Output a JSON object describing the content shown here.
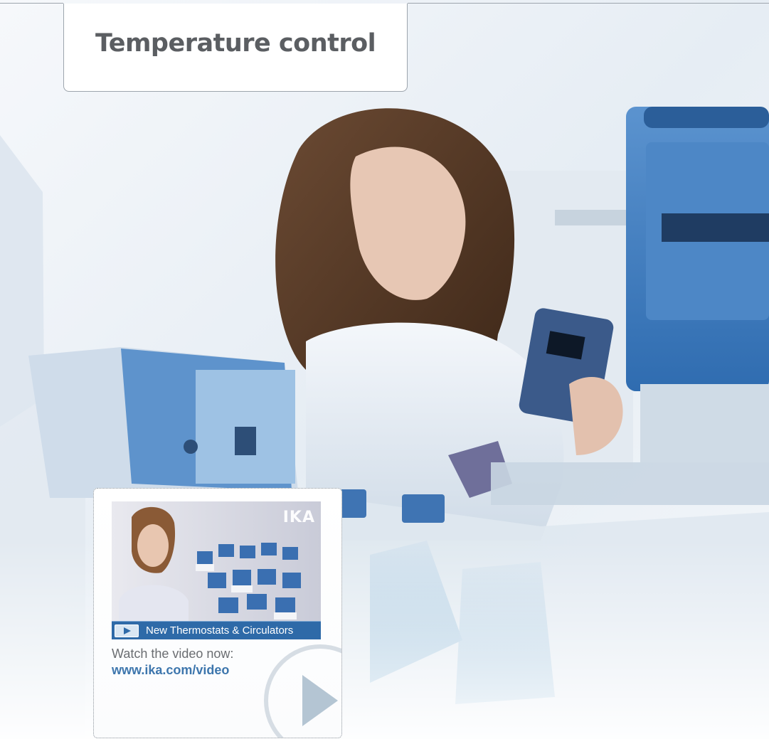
{
  "header": {
    "title": "Temperature control"
  },
  "video_teaser": {
    "thumbnail_caption": "New Thermostats & Circulators",
    "brand_logo": "IKA",
    "watch_label": "Watch the video now:",
    "link_text": "www.ika.com/video",
    "play_icon": "play-icon"
  },
  "colors": {
    "accent_blue": "#2e6aa8",
    "link_blue": "#3d76ad",
    "title_gray": "#5b5e62",
    "device_blue": "#3f7fc4"
  }
}
